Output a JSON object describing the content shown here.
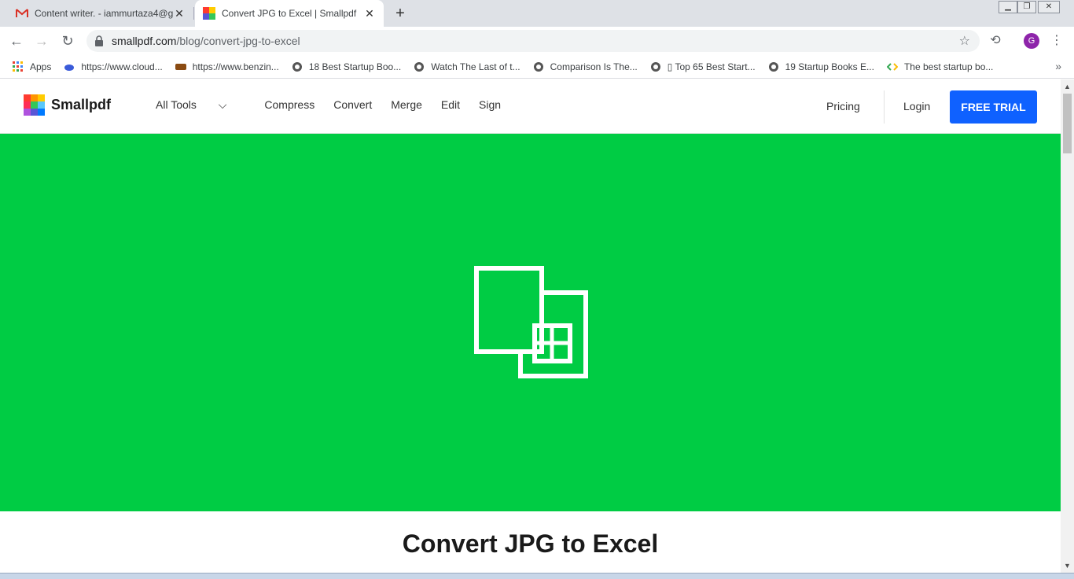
{
  "tabs": [
    {
      "title": "Content writer. - iammurtaza4@g",
      "icon": "gmail-icon"
    },
    {
      "title": "Convert JPG to Excel | Smallpdf",
      "icon": "smallpdf-icon"
    }
  ],
  "address": {
    "host": "smallpdf.com",
    "path": "/blog/convert-jpg-to-excel"
  },
  "avatar_letter": "G",
  "bookmarks": [
    {
      "label": "Apps",
      "icon": "apps-grid-icon"
    },
    {
      "label": "https://www.cloud...",
      "icon": "cloud-icon"
    },
    {
      "label": "https://www.benzin...",
      "icon": "benzinga-icon"
    },
    {
      "label": "18 Best Startup Boo...",
      "icon": "globe-icon"
    },
    {
      "label": "Watch The Last of t...",
      "icon": "globe-icon"
    },
    {
      "label": "Comparison Is The...",
      "icon": "globe-icon"
    },
    {
      "label": "▯ Top 65 Best Start...",
      "icon": "globe-icon"
    },
    {
      "label": "19 Startup Books E...",
      "icon": "globe-icon"
    },
    {
      "label": "The best startup bo...",
      "icon": "code-icon"
    }
  ],
  "site": {
    "logo_text": "Smallpdf",
    "nav": [
      "All Tools",
      "Compress",
      "Convert",
      "Merge",
      "Edit",
      "Sign"
    ],
    "pricing": "Pricing",
    "login": "Login",
    "cta": "FREE TRIAL"
  },
  "hero": {
    "color": "#00cc44",
    "icon": "jpg-to-excel-icon"
  },
  "article": {
    "title": "Convert JPG to Excel"
  },
  "colors": {
    "cta": "#0f61ff",
    "hero": "#00cc44"
  }
}
